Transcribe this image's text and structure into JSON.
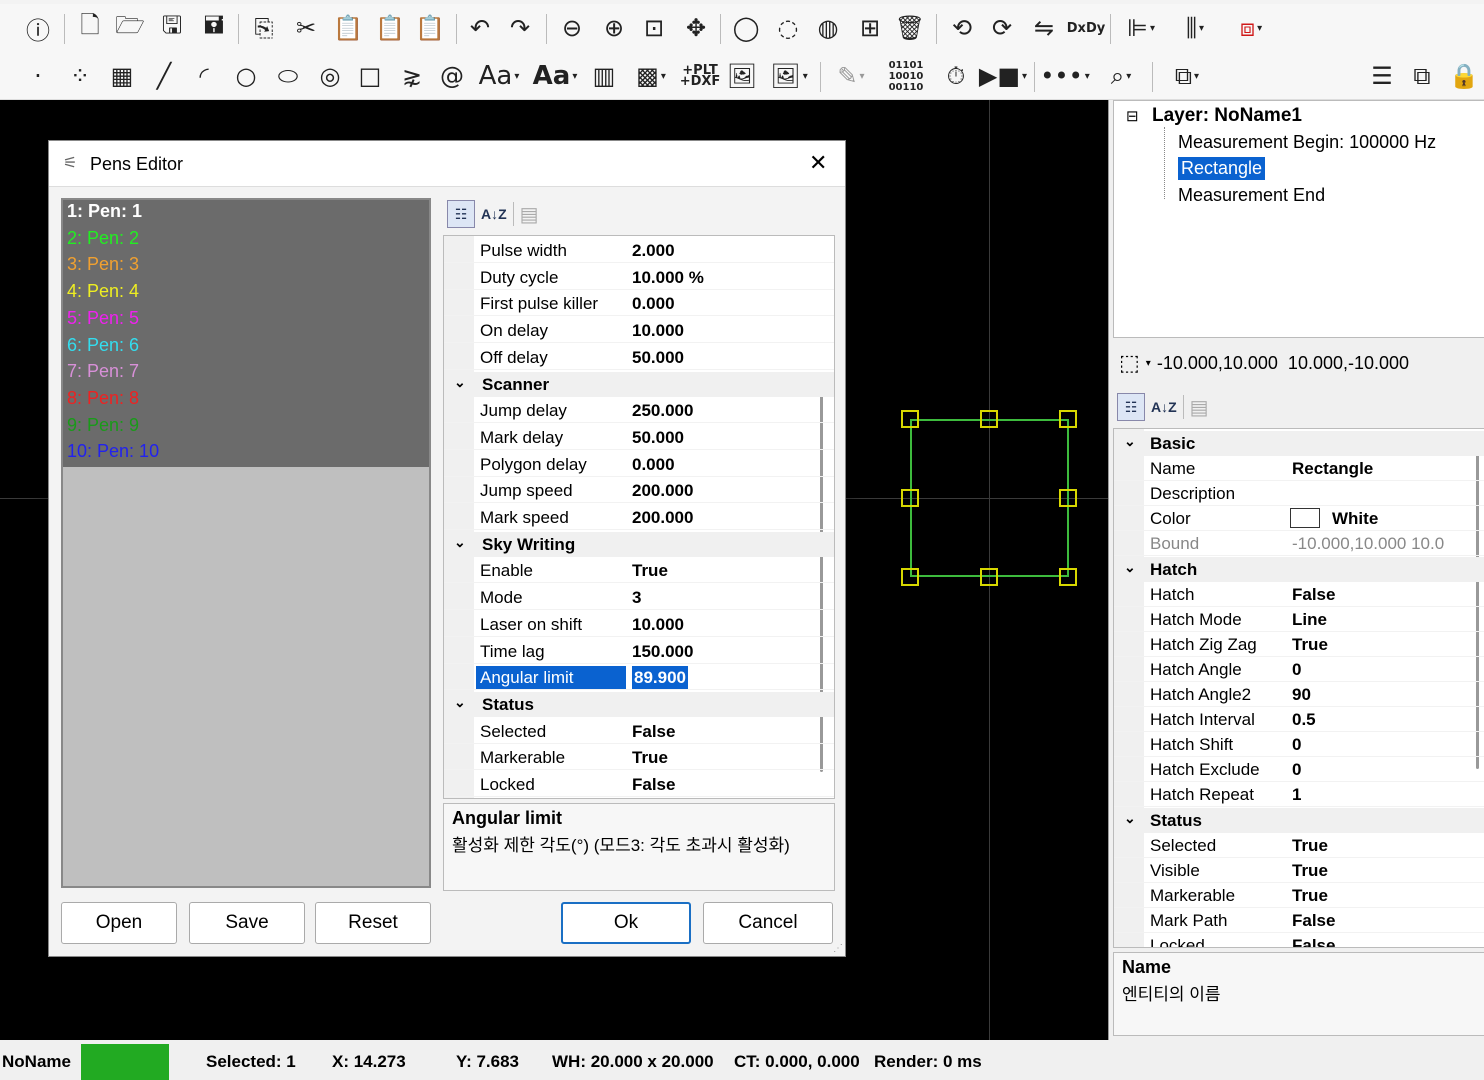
{
  "toolbar1": {
    "icons": [
      "info-icon",
      "new-file-icon",
      "open-folder-icon",
      "save-icon",
      "save-as-icon",
      "copy-icon",
      "cut-icon",
      "paste-icon",
      "clipboard-icon",
      "paste-special-icon",
      "undo-icon",
      "redo-icon",
      "zoom-out-icon",
      "zoom-in-icon",
      "zoom-fit-icon",
      "pan-icon",
      "circle-select-icon",
      "lasso-icon",
      "hatch-icon",
      "group-icon",
      "delete-icon",
      "rotate-ccw-icon",
      "rotate-cw-icon",
      "flip-icon",
      "dxdy-icon",
      "align-left-icon",
      "columns-icon",
      "stop-icon"
    ],
    "dxdy_label": "DxDy"
  },
  "toolbar2": {
    "aa1": "Aa",
    "aa2": "Aa",
    "plt_dxf": "+PLT +DXF",
    "binary": "01101 10010 00110"
  },
  "layer_tree": {
    "layer": "Layer: NoName1",
    "items": [
      "Measurement Begin: 100000 Hz",
      "Rectangle",
      "Measurement End"
    ]
  },
  "bound_readout": "-10.000,10.000  10.000,-10.000",
  "entity_props": {
    "cats": [
      {
        "name": "Basic",
        "rows": [
          [
            "Name",
            "Rectangle"
          ],
          [
            "Description",
            ""
          ],
          [
            "Color",
            "White"
          ],
          [
            "Bound",
            "-10.000,10.000  10.0"
          ]
        ]
      },
      {
        "name": "Hatch",
        "rows": [
          [
            "Hatch",
            "False"
          ],
          [
            "Hatch Mode",
            "Line"
          ],
          [
            "Hatch Zig Zag",
            "True"
          ],
          [
            "Hatch Angle",
            "0"
          ],
          [
            "Hatch Angle2",
            "90"
          ],
          [
            "Hatch Interval",
            "0.5"
          ],
          [
            "Hatch Shift",
            "0"
          ],
          [
            "Hatch Exclude",
            "0"
          ],
          [
            "Hatch Repeat",
            "1"
          ]
        ]
      },
      {
        "name": "Status",
        "rows": [
          [
            "Selected",
            "True"
          ],
          [
            "Visible",
            "True"
          ],
          [
            "Markerable",
            "True"
          ],
          [
            "Mark Path",
            "False"
          ],
          [
            "Locked",
            "False"
          ]
        ]
      }
    ],
    "desc_title": "Name",
    "desc_text": "엔티티의 이름"
  },
  "dialog": {
    "title": "Pens Editor",
    "close": "✕",
    "pens": [
      {
        "label": "1: Pen: 1",
        "color": "#ffffff"
      },
      {
        "label": "2: Pen: 2",
        "color": "#22ee22"
      },
      {
        "label": "3: Pen: 3",
        "color": "#f0a030"
      },
      {
        "label": "4: Pen: 4",
        "color": "#eeee22"
      },
      {
        "label": "5: Pen: 5",
        "color": "#ee22ee"
      },
      {
        "label": "6: Pen: 6",
        "color": "#33ddee"
      },
      {
        "label": "7: Pen: 7",
        "color": "#d890d8"
      },
      {
        "label": "8: Pen: 8",
        "color": "#ee2222"
      },
      {
        "label": "9: Pen: 9",
        "color": "#1a9a1a"
      },
      {
        "label": "10: Pen: 10",
        "color": "#2222ee"
      }
    ],
    "props": [
      {
        "type": "row",
        "k": "Pulse width",
        "v": "2.000"
      },
      {
        "type": "row",
        "k": "Duty cycle",
        "v": "10.000 %"
      },
      {
        "type": "row",
        "k": "First pulse killer",
        "v": "0.000"
      },
      {
        "type": "row",
        "k": "On delay",
        "v": "10.000"
      },
      {
        "type": "row",
        "k": "Off delay",
        "v": "50.000"
      },
      {
        "type": "cat",
        "k": "Scanner"
      },
      {
        "type": "row",
        "k": "Jump delay",
        "v": "250.000"
      },
      {
        "type": "row",
        "k": "Mark delay",
        "v": "50.000"
      },
      {
        "type": "row",
        "k": "Polygon delay",
        "v": "0.000"
      },
      {
        "type": "row",
        "k": "Jump speed",
        "v": "200.000"
      },
      {
        "type": "row",
        "k": "Mark speed",
        "v": "200.000"
      },
      {
        "type": "cat",
        "k": "Sky Writing"
      },
      {
        "type": "row",
        "k": "Enable",
        "v": "True"
      },
      {
        "type": "row",
        "k": "Mode",
        "v": "3"
      },
      {
        "type": "row",
        "k": "Laser on shift",
        "v": "10.000"
      },
      {
        "type": "row",
        "k": "Time lag",
        "v": "150.000"
      },
      {
        "type": "row",
        "k": "Angular limit",
        "v": "89.900",
        "selected": true
      },
      {
        "type": "cat",
        "k": "Status"
      },
      {
        "type": "row",
        "k": "Selected",
        "v": "False"
      },
      {
        "type": "row",
        "k": "Markerable",
        "v": "True"
      },
      {
        "type": "row",
        "k": "Locked",
        "v": "False"
      }
    ],
    "desc_title": "Angular limit",
    "desc_text": "활성화 제한 각도(°) (모드3: 각도 초과시 활성화)",
    "buttons": {
      "open": "Open",
      "save": "Save",
      "reset": "Reset",
      "ok": "Ok",
      "cancel": "Cancel"
    }
  },
  "status": {
    "name": "NoName",
    "name_color": "#22aa22",
    "selected": "Selected: 1",
    "x": "X: 14.273",
    "y": "Y: 7.683",
    "wh": "WH: 20.000 x 20.000",
    "ct": "CT: 0.000, 0.000",
    "render": "Render: 0 ms"
  }
}
